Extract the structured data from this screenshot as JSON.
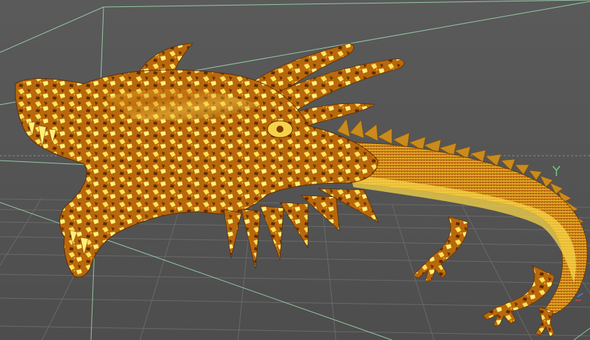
{
  "viewport": {
    "background_color": "#545454",
    "grid_line_color": "#6a6a6a",
    "bounding_box_color": "#9fe0b4",
    "horizon_color": "#8a8a8a",
    "model_colors": {
      "dark": "#7a3d00",
      "mid": "#c8790c",
      "bright": "#f2b21f",
      "highlight": "#fff07a"
    },
    "axis_gizmo": {
      "x_color": "#cf4a3a",
      "y_color": "#6ed27a",
      "z_color": "#5a7bd8"
    }
  }
}
